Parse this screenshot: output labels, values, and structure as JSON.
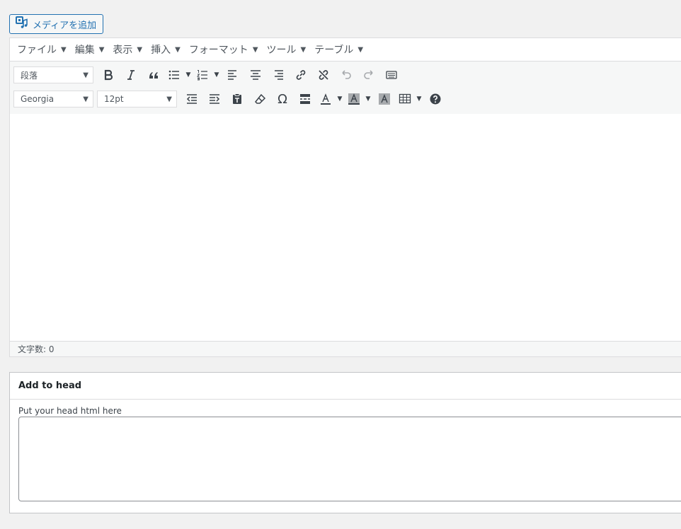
{
  "media_button": {
    "label": "メディアを追加",
    "icon": "media-icon"
  },
  "menubar": {
    "items": [
      {
        "label": "ファイル"
      },
      {
        "label": "編集"
      },
      {
        "label": "表示"
      },
      {
        "label": "挿入"
      },
      {
        "label": "フォーマット"
      },
      {
        "label": "ツール"
      },
      {
        "label": "テーブル"
      }
    ]
  },
  "toolbar": {
    "format_select": "段落",
    "font_select": "Georgia",
    "size_select": "12pt"
  },
  "status": {
    "word_count": "文字数: 0"
  },
  "metabox": {
    "title": "Add to head",
    "label": "Put your head html here",
    "value": ""
  }
}
